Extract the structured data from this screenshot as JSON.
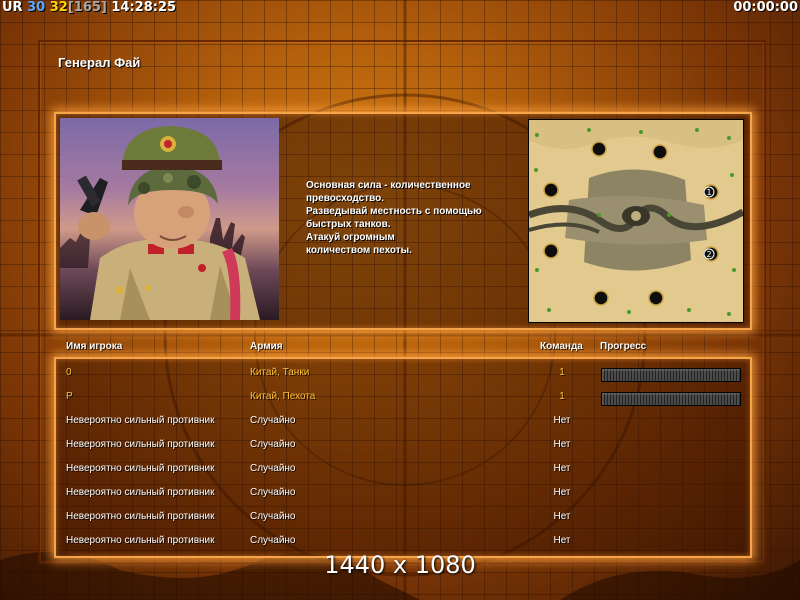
{
  "hud": {
    "ur": "UR",
    "val1": "30",
    "val2": "32",
    "val3": "[165]",
    "clock": "14:28:25",
    "timer": "00:00:00"
  },
  "briefing": {
    "title": "Генерал Фай",
    "description": "Основная сила - количественное\n превосходство.\nРазведывай местность с помощью\n быстрых танков.\nАтакуй огромным\nколичеством пехоты."
  },
  "minimap": {
    "start_labels": [
      "1",
      "2"
    ]
  },
  "table": {
    "headers": {
      "player": "Имя игрока",
      "army": "Армия",
      "team": "Команда",
      "progress": "Прогресс"
    },
    "rows": [
      {
        "name": "0",
        "army": "Китай, Танки",
        "team": "1",
        "type": "human",
        "progress": 1.0
      },
      {
        "name": "P",
        "army": "Китай, Пехота",
        "team": "1",
        "type": "human",
        "progress": 1.0
      },
      {
        "name": "Невероятно сильный противник",
        "army": "Случайно",
        "team": "Нет",
        "type": "ai"
      },
      {
        "name": "Невероятно сильный противник",
        "army": "Случайно",
        "team": "Нет",
        "type": "ai"
      },
      {
        "name": "Невероятно сильный противник",
        "army": "Случайно",
        "team": "Нет",
        "type": "ai"
      },
      {
        "name": "Невероятно сильный противник",
        "army": "Случайно",
        "team": "Нет",
        "type": "ai"
      },
      {
        "name": "Невероятно сильный противник",
        "army": "Случайно",
        "team": "Нет",
        "type": "ai"
      },
      {
        "name": "Невероятно сильный противник",
        "army": "Случайно",
        "team": "Нет",
        "type": "ai"
      }
    ]
  },
  "overlay": {
    "resolution": "1440 x 1080"
  },
  "colors": {
    "human_text": "#ffc53a",
    "ai_text": "#ffffff",
    "panel_glow": "#f6a44a"
  }
}
